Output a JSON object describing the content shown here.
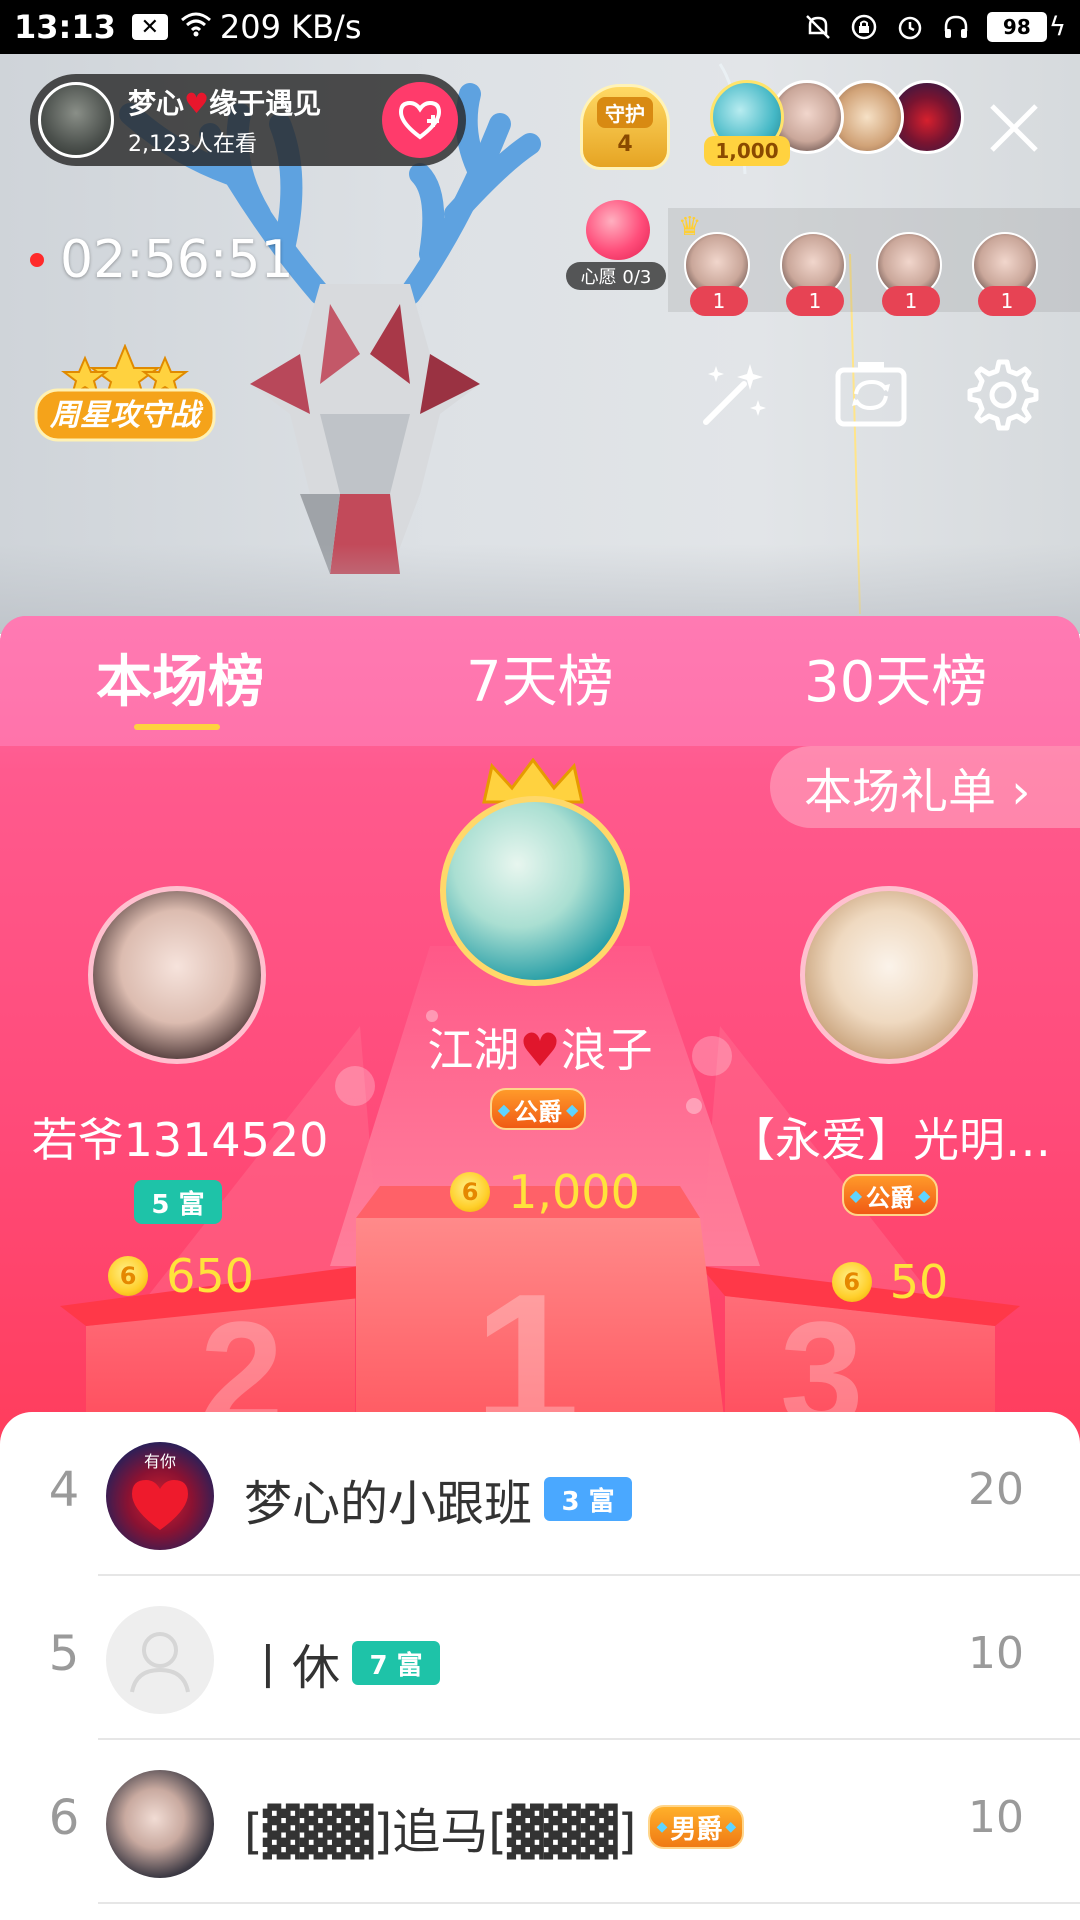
{
  "status_bar": {
    "time": "13:13",
    "network_speed": "209 KB/s",
    "battery": "98",
    "icons": [
      "notification-x-icon",
      "wifi-icon",
      "mute-bell-icon",
      "lock-rotate-icon",
      "alarm-icon",
      "headphone-icon",
      "battery-icon"
    ]
  },
  "live": {
    "anchor_name_prefix": "梦心",
    "anchor_name_suffix": "缘于遇见",
    "viewers": "2,123人在看",
    "guard_label": "守护",
    "guard_count": "4",
    "top_viewer_value": "1,000",
    "timer": "02:56:51",
    "wish_label": "心愿 0/3",
    "fan_counts": [
      "1",
      "1",
      "1",
      "1"
    ],
    "weekly_star_label": "周星攻守战"
  },
  "tabs": [
    {
      "label": "本场榜",
      "active": true
    },
    {
      "label": "7天榜",
      "active": false
    },
    {
      "label": "30天榜",
      "active": false
    }
  ],
  "gift_list_button": "本场礼单 ›",
  "podium": {
    "first": {
      "name_prefix": "江湖",
      "name_suffix": "浪子",
      "badge": "公爵",
      "value": "1,000"
    },
    "second": {
      "name": "若爷1314520",
      "badge": "5 富",
      "value": "650",
      "podium_number": "2"
    },
    "third": {
      "name": "【永爱】光明…",
      "badge": "公爵",
      "value": "50",
      "podium_number": "3"
    },
    "first_podium_number": "1"
  },
  "ranking": [
    {
      "rank": "4",
      "name": "梦心的小跟班",
      "badge": "3 富",
      "badge_color": "#4aa8ff",
      "score": "20",
      "avatar_text": "有你"
    },
    {
      "rank": "5",
      "name": "丨休",
      "badge": "7 富",
      "badge_color": "#1ec3a8",
      "score": "10"
    },
    {
      "rank": "6",
      "name": "[▓▓▓]追马[▓▓▓]",
      "badge": "男爵",
      "badge_color": "#f07a14",
      "score": "10"
    }
  ],
  "colors": {
    "accent_pink": "#ff4a78",
    "tab_underline": "#ffd23f",
    "coin_value": "#ffe33b",
    "rich_badge_teal": "#1ec3a8"
  }
}
